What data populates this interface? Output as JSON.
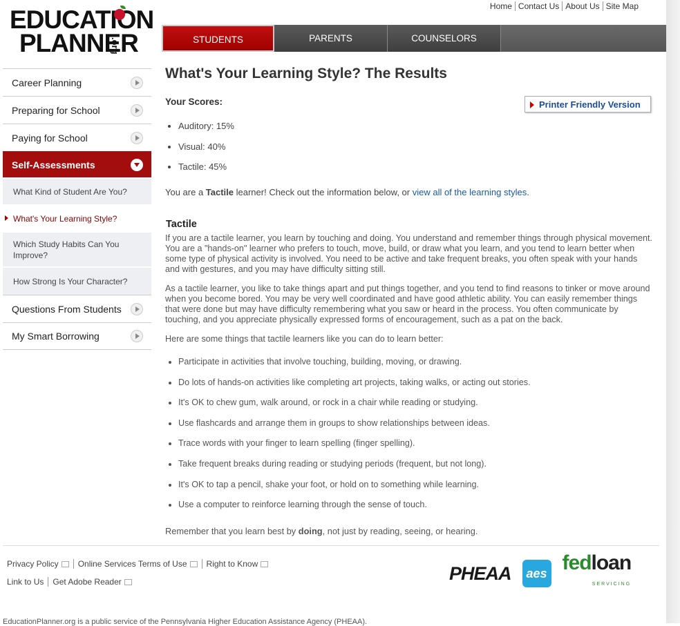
{
  "logo": {
    "line1": "EDUCATION",
    "line2": "PLANNER",
    "org": ".org"
  },
  "top_links": [
    "Home",
    "Contact Us",
    "About Us",
    "Site Map"
  ],
  "tabs": [
    {
      "label": "STUDENTS",
      "active": true
    },
    {
      "label": "PARENTS",
      "active": false
    },
    {
      "label": "COUNSELORS",
      "active": false
    }
  ],
  "sidebar": {
    "items": [
      {
        "label": "Career Planning"
      },
      {
        "label": "Preparing for School"
      },
      {
        "label": "Paying for School"
      },
      {
        "label": "Self-Assessments",
        "active": true
      }
    ],
    "sub_items": [
      {
        "label": "What Kind of Student Are You?"
      },
      {
        "label": "What's Your Learning Style?",
        "current": true
      },
      {
        "label": "Which Study Habits Can You Improve?"
      },
      {
        "label": "How Strong Is Your Character?"
      }
    ],
    "after_items": [
      {
        "label": "Questions From Students"
      },
      {
        "label": "My Smart Borrowing"
      }
    ]
  },
  "main": {
    "title": "What's Your Learning Style? The Results",
    "scores_label": "Your Scores:",
    "printer_label": "Printer Friendly Version",
    "scores": [
      "Auditory: 15%",
      "Visual: 40%",
      "Tactile: 45%"
    ],
    "result_prefix": "You are a ",
    "result_style": "Tactile",
    "result_middle": " learner! Check out the information below, or ",
    "result_link": "view all of the learning styles",
    "result_suffix": ".",
    "section_heading": "Tactile",
    "para1": "If you are a tactile learner, you learn by touching and doing. You understand and remember things through physical movement. You are a \"hands-on\" learner who prefers to touch, move, build, or draw what you learn, and you tend to learn better when some type of physical activity is involved. You need to be active and take frequent breaks, you often speak with your hands and with gestures, and you may have difficulty sitting still.",
    "para2": "As a tactile learner, you like to take things apart and put things together, and you tend to find reasons to tinker or move around when you become bored. You may be very well coordinated and have good athletic ability. You can easily remember things that were done but may have difficulty remembering what you saw or heard in the process. You often communicate by touching, and you appreciate physically expressed forms of encouragement, such as a pat on the back.",
    "para3": "Here are some things that tactile learners like you can do to learn better:",
    "tips": [
      "Participate in activities that involve touching, building, moving, or drawing.",
      "Do lots of hands-on activities like completing art projects, taking walks, or acting out stories.",
      "It's OK to chew gum, walk around, or rock in a chair while reading or studying.",
      "Use flashcards and arrange them in groups to show relationships between ideas.",
      "Trace words with your finger to learn spelling (finger spelling).",
      "Take frequent breaks during reading or studying periods (frequent, but not long).",
      "It's OK to tap a pencil, shake your foot, or hold on to something while learning.",
      "Use a computer to reinforce learning through the sense of touch."
    ],
    "remember_prefix": "Remember that you learn best by ",
    "remember_bold": "doing",
    "remember_suffix": ", not just by reading, seeing, or hearing."
  },
  "footer": {
    "row1": [
      "Privacy Policy",
      "Online Services Terms of Use",
      "Right to Know"
    ],
    "row2": [
      "Link to Us",
      "Get Adobe Reader"
    ],
    "logos": {
      "pheaa": "PHEAA",
      "aes": "aes",
      "fed": "fed",
      "loan": "loan",
      "servicing": "SERVICING"
    },
    "disclaimer": "EducationPlanner.org is a public service of the Pennsylvania Higher Education Assistance Agency (PHEAA)."
  }
}
